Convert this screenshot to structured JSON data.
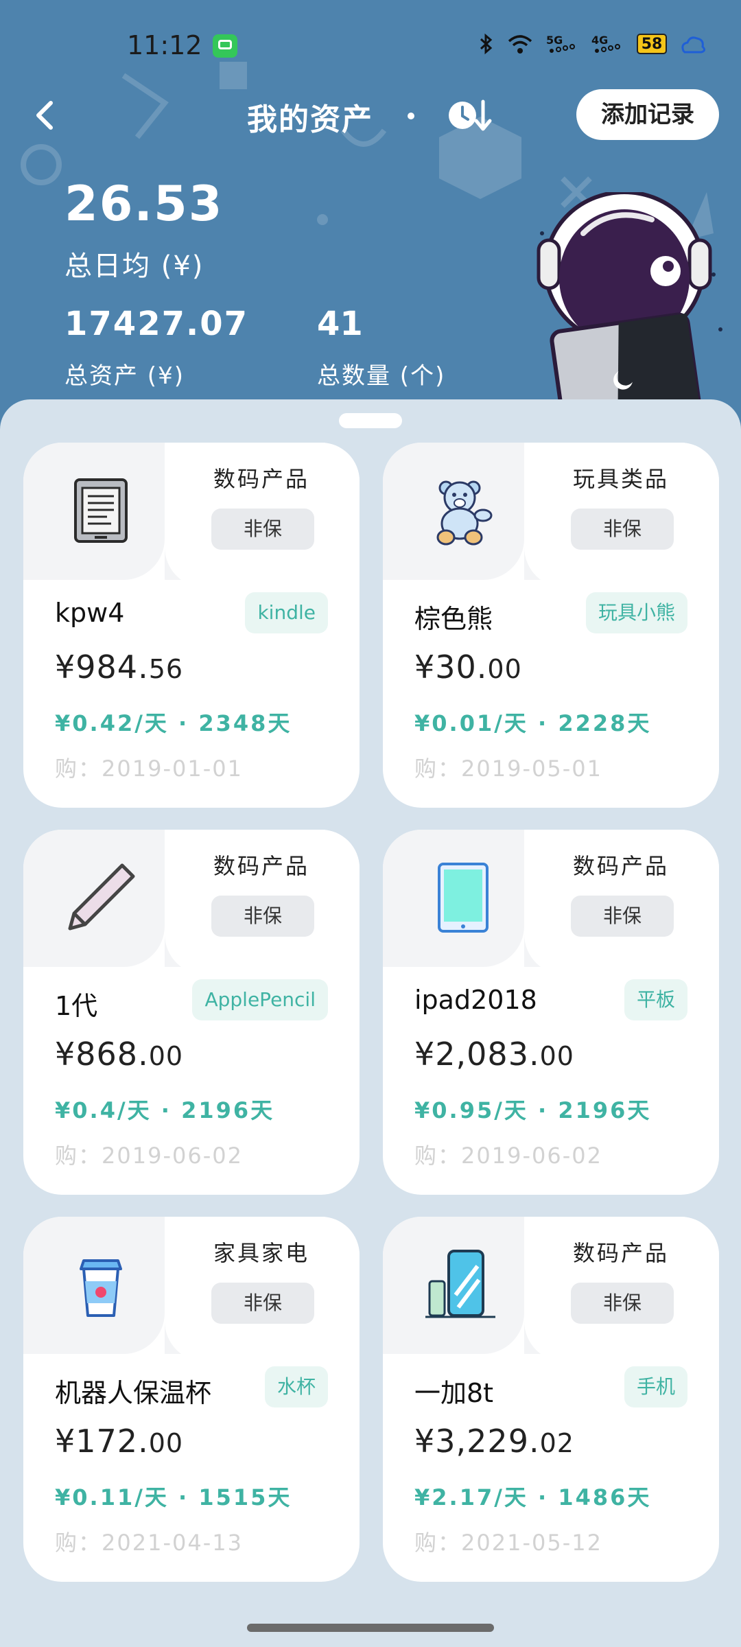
{
  "status_bar": {
    "time": "11:12",
    "network_icons": [
      "bluetooth-icon",
      "wifi-icon",
      "5g-signal-icon",
      "4g-signal-icon"
    ],
    "battery": "58"
  },
  "nav": {
    "title": "我的资产",
    "add_button": "添加记录"
  },
  "summary": {
    "daily_avg_value": "26.53",
    "daily_avg_label": "总日均 (¥)",
    "total_assets_value": "17427.07",
    "total_assets_label": "总资产 (¥)",
    "total_count_value": "41",
    "total_count_label": "总数量 (个)"
  },
  "colors": {
    "header_bg": "#4e83ad",
    "accent": "#3fb3a3",
    "sheet_bg": "#d6e2ec"
  },
  "items": [
    {
      "icon": "kindle-icon",
      "category": "数码产品",
      "insurance": "非保",
      "name": "kpw4",
      "tag": "kindle",
      "price_main": "¥984.",
      "price_dec": "56",
      "daily": "¥0.42/天 · 2348天",
      "date": "购：2019-01-01"
    },
    {
      "icon": "teddy-bear-icon",
      "category": "玩具类品",
      "insurance": "非保",
      "name": "棕色熊",
      "tag": "玩具小熊",
      "price_main": "¥30.",
      "price_dec": "00",
      "daily": "¥0.01/天 · 2228天",
      "date": "购：2019-05-01"
    },
    {
      "icon": "pencil-icon",
      "category": "数码产品",
      "insurance": "非保",
      "name": "1代",
      "tag": "ApplePencil",
      "price_main": "¥868.",
      "price_dec": "00",
      "daily": "¥0.4/天 · 2196天",
      "date": "购：2019-06-02"
    },
    {
      "icon": "tablet-icon",
      "category": "数码产品",
      "insurance": "非保",
      "name": "ipad2018",
      "tag": "平板",
      "price_main": "¥2,083.",
      "price_dec": "00",
      "daily": "¥0.95/天 · 2196天",
      "date": "购：2019-06-02"
    },
    {
      "icon": "cup-icon",
      "category": "家具家电",
      "insurance": "非保",
      "name": "机器人保温杯",
      "tag": "水杯",
      "price_main": "¥172.",
      "price_dec": "00",
      "daily": "¥0.11/天 · 1515天",
      "date": "购：2021-04-13"
    },
    {
      "icon": "phone-icon",
      "category": "数码产品",
      "insurance": "非保",
      "name": "一加8t",
      "tag": "手机",
      "price_main": "¥3,229.",
      "price_dec": "02",
      "daily": "¥2.17/天 · 1486天",
      "date": "购：2021-05-12"
    }
  ]
}
